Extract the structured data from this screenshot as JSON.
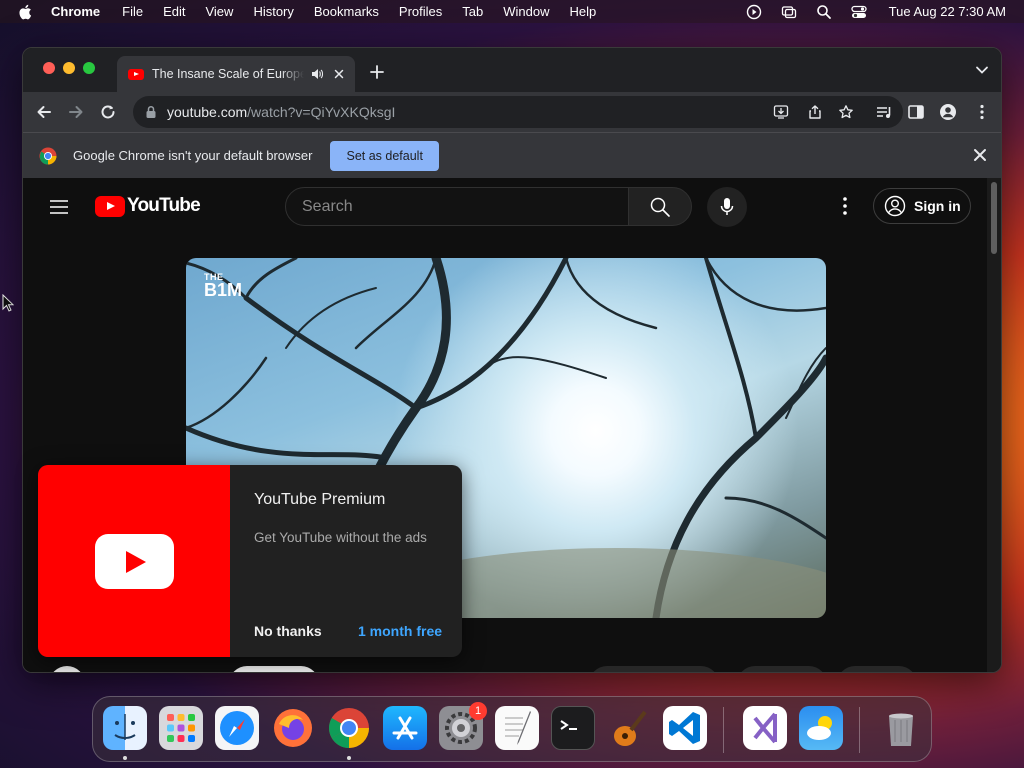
{
  "menubar": {
    "app_name": "Chrome",
    "items": [
      "File",
      "Edit",
      "View",
      "History",
      "Bookmarks",
      "Profiles",
      "Tab",
      "Window",
      "Help"
    ],
    "clock": "Tue Aug 22  7:30 AM"
  },
  "browser": {
    "tab_title": "The Insane Scale of Europe",
    "url_host": "youtube.com",
    "url_path": "/watch?v=QiYvXKQksgI",
    "infobar_text": "Google Chrome isn't your default browser",
    "infobar_button": "Set as default"
  },
  "youtube": {
    "logo_text": "YouTube",
    "search_placeholder": "Search",
    "signin_label": "Sign in",
    "video_watermark_top": "THE",
    "video_watermark_main": "B1M"
  },
  "premium_popup": {
    "title": "YouTube Premium",
    "subtitle": "Get YouTube without the ads",
    "dismiss_label": "No thanks",
    "trial_label": "1 month free"
  },
  "dock": {
    "apps": [
      "finder",
      "launchpad",
      "safari",
      "firefox",
      "chrome",
      "app-store",
      "system-settings",
      "textedit",
      "terminal",
      "garageband",
      "vscode",
      "visual-studio",
      "weather",
      "trash"
    ],
    "system_settings_badge": "1"
  },
  "colors": {
    "youtube_red": "#ff0000",
    "chrome_toolbar": "#35363a",
    "link_blue": "#3ea6ff",
    "infobar_button": "#8ab4f8"
  }
}
